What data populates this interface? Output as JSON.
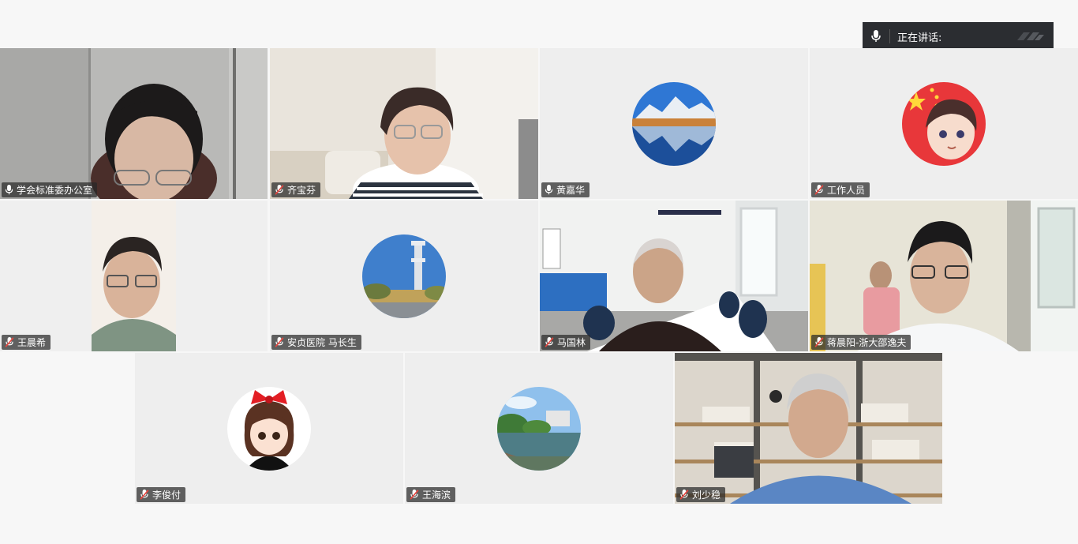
{
  "speaking_bar": {
    "label": "正在讲话:",
    "mic_icon": "microphone-icon"
  },
  "participants": [
    {
      "name": "学会标准委办公室",
      "muted": false,
      "type": "video"
    },
    {
      "name": "齐宝芬",
      "muted": true,
      "type": "video"
    },
    {
      "name": "黄嘉华",
      "muted": false,
      "type": "avatar",
      "avatar": "mountain-lake"
    },
    {
      "name": "工作人员",
      "muted": true,
      "type": "avatar",
      "avatar": "flag-cartoon-boy"
    },
    {
      "name": "王晨希",
      "muted": true,
      "type": "video"
    },
    {
      "name": "安贞医院 马长生",
      "muted": true,
      "type": "avatar",
      "avatar": "tower-park"
    },
    {
      "name": "马国林",
      "muted": true,
      "type": "video"
    },
    {
      "name": "蒋晨阳-浙大邵逸夫",
      "muted": true,
      "type": "video"
    },
    {
      "name": "李俊付",
      "muted": true,
      "type": "avatar",
      "avatar": "cartoon-girl-red-bow"
    },
    {
      "name": "王海滨",
      "muted": true,
      "type": "avatar",
      "avatar": "campus-lake"
    },
    {
      "name": "刘少稳",
      "muted": true,
      "type": "video"
    }
  ],
  "colors": {
    "label_bg": "#2d2d2d",
    "mute_red": "#e8463f",
    "tile_bg": "#eeeeee",
    "page_bg": "#f7f7f7"
  }
}
